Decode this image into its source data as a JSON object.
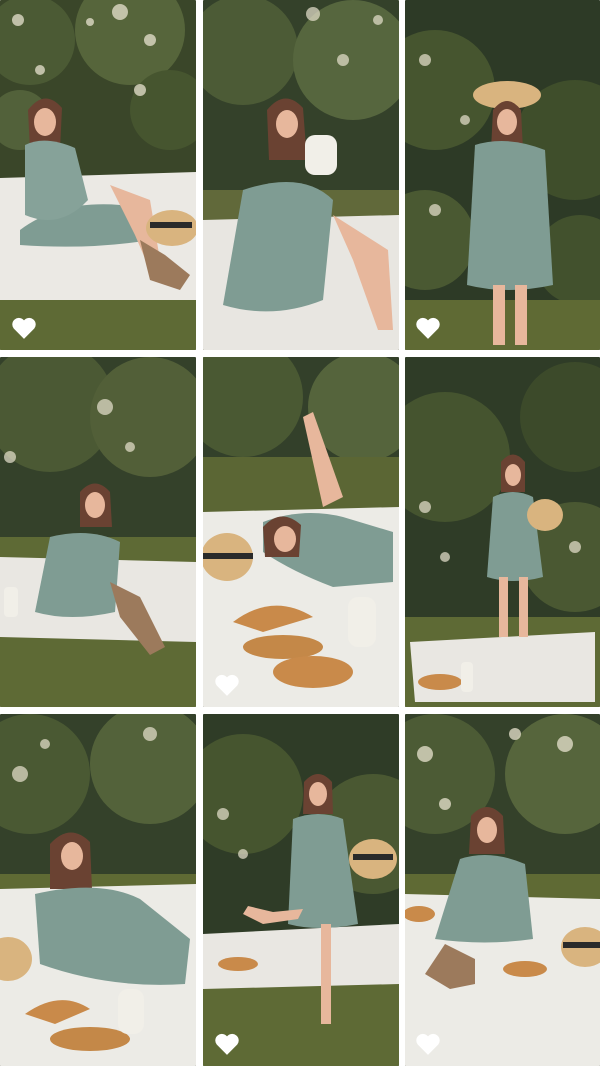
{
  "layout": {
    "columns": 3,
    "rows": 3
  },
  "colors": {
    "background": "#ffffff",
    "foliage_dark": "#2f3b24",
    "foliage_mid": "#4c5a35",
    "grass": "#5f6a34",
    "blanket": "#e9e7e2",
    "dress": "#7f9c93",
    "skin": "#e7b79c",
    "hair": "#6a4232",
    "straw_hat": "#d9b47f",
    "bread": "#c98a4a",
    "milk": "#f1efe8",
    "heart_fill": "#ffffff"
  },
  "photos": [
    {
      "id": "photo-1",
      "pose": "sitting-hand-on-chin",
      "has_hat": true,
      "has_bread": false,
      "liked_icon": "heart-icon"
    },
    {
      "id": "photo-2",
      "pose": "drinking-milk",
      "has_hat": false,
      "has_bread": false,
      "liked_icon": null
    },
    {
      "id": "photo-3",
      "pose": "standing-holding-hat",
      "has_hat": true,
      "has_bread": false,
      "liked_icon": "heart-icon"
    },
    {
      "id": "photo-4",
      "pose": "sitting-on-blanket",
      "has_hat": false,
      "has_bread": false,
      "liked_icon": null
    },
    {
      "id": "photo-5",
      "pose": "lying-with-bread",
      "has_hat": true,
      "has_bread": true,
      "liked_icon": "heart-icon"
    },
    {
      "id": "photo-6",
      "pose": "standing-with-hat",
      "has_hat": true,
      "has_bread": true,
      "liked_icon": null
    },
    {
      "id": "photo-7",
      "pose": "reclining-with-bread",
      "has_hat": true,
      "has_bread": true,
      "liked_icon": null
    },
    {
      "id": "photo-8",
      "pose": "dancing-with-hat",
      "has_hat": true,
      "has_bread": true,
      "liked_icon": "heart-icon"
    },
    {
      "id": "photo-9",
      "pose": "sitting-eating-croissant",
      "has_hat": true,
      "has_bread": true,
      "liked_icon": "heart-icon"
    }
  ]
}
